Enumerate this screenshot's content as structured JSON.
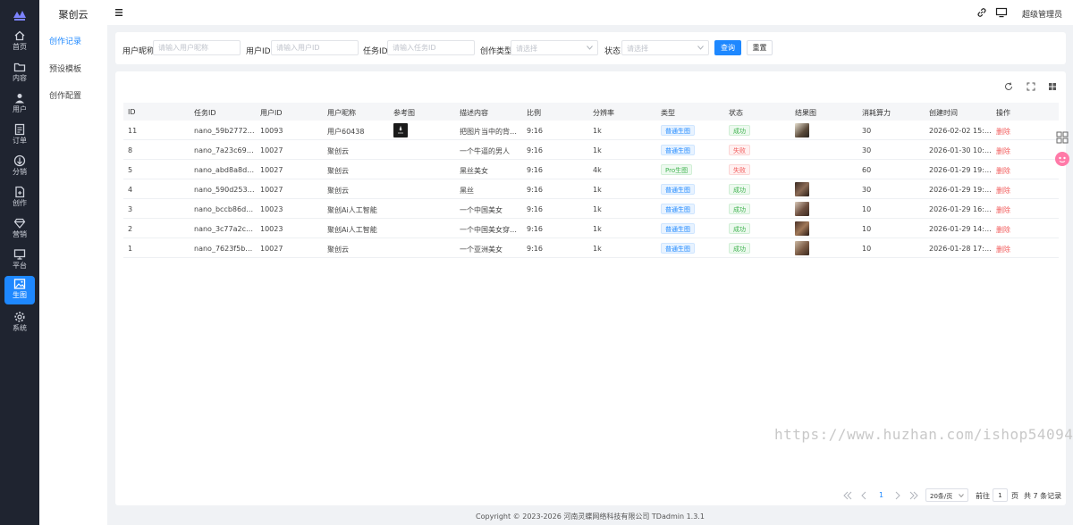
{
  "app": {
    "name": "聚创云"
  },
  "rail": [
    {
      "label": "首页",
      "icon": "home-icon"
    },
    {
      "label": "内容",
      "icon": "folder-icon"
    },
    {
      "label": "用户",
      "icon": "user-icon"
    },
    {
      "label": "订单",
      "icon": "order-icon"
    },
    {
      "label": "分销",
      "icon": "distribution-icon"
    },
    {
      "label": "创作",
      "icon": "create-icon"
    },
    {
      "label": "营销",
      "icon": "diamond-icon"
    },
    {
      "label": "平台",
      "icon": "monitor-icon"
    },
    {
      "label": "生图",
      "icon": "image-icon"
    },
    {
      "label": "系统",
      "icon": "gear-icon"
    }
  ],
  "subnav": {
    "title": "聚创云",
    "items": [
      "创作记录",
      "预设模板",
      "创作配置"
    ]
  },
  "header": {
    "user": "超级管理员"
  },
  "filters": {
    "user_name_label": "用户昵称",
    "user_name_placeholder": "请输入用户昵称",
    "user_id_label": "用户ID",
    "user_id_placeholder": "请输入用户ID",
    "task_id_label": "任务ID",
    "task_id_placeholder": "请输入任务ID",
    "type_label": "创作类型",
    "type_placeholder": "请选择",
    "status_label": "状态",
    "status_placeholder": "请选择",
    "search_btn": "查询",
    "reset_btn": "重置"
  },
  "table": {
    "columns": [
      "ID",
      "任务ID",
      "用户ID",
      "用户昵称",
      "参考图",
      "描述内容",
      "比例",
      "分辨率",
      "类型",
      "状态",
      "结果图",
      "消耗算力",
      "创建时间",
      "操作"
    ],
    "rows": [
      {
        "id": "11",
        "task": "nano_59b27724f4...",
        "uid": "10093",
        "nick": "用户60438",
        "ref": true,
        "desc": "把图片当中的背景...",
        "ratio": "9:16",
        "res": "1k",
        "type": "普通生图",
        "type_kind": "blue",
        "status": "成功",
        "status_kind": "green",
        "result": true,
        "cost": "30",
        "time": "2026-02-02 15:57:...",
        "op": "删除"
      },
      {
        "id": "8",
        "task": "nano_7a23c69780...",
        "uid": "10027",
        "nick": "聚创云",
        "ref": false,
        "desc": "一个牛逼的男人",
        "ratio": "9:16",
        "res": "1k",
        "type": "普通生图",
        "type_kind": "blue",
        "status": "失败",
        "status_kind": "red",
        "result": false,
        "cost": "30",
        "time": "2026-01-30 10:38:...",
        "op": "删除"
      },
      {
        "id": "5",
        "task": "nano_abd8a8d97...",
        "uid": "10027",
        "nick": "聚创云",
        "ref": false,
        "desc": "黑丝美女",
        "ratio": "9:16",
        "res": "4k",
        "type": "Pro生图",
        "type_kind": "green",
        "status": "失败",
        "status_kind": "red",
        "result": false,
        "cost": "60",
        "time": "2026-01-29 19:39:...",
        "op": "删除"
      },
      {
        "id": "4",
        "task": "nano_590d2533a...",
        "uid": "10027",
        "nick": "聚创云",
        "ref": false,
        "desc": "黑丝",
        "ratio": "9:16",
        "res": "1k",
        "type": "普通生图",
        "type_kind": "blue",
        "status": "成功",
        "status_kind": "green",
        "result": true,
        "cost": "30",
        "time": "2026-01-29 19:39:...",
        "op": "删除"
      },
      {
        "id": "3",
        "task": "nano_bccb86d358...",
        "uid": "10023",
        "nick": "聚创Ai人工智能",
        "ref": false,
        "desc": "一个中国美女",
        "ratio": "9:16",
        "res": "1k",
        "type": "普通生图",
        "type_kind": "blue",
        "status": "成功",
        "status_kind": "green",
        "result": true,
        "cost": "10",
        "time": "2026-01-29 16:51:...",
        "op": "删除"
      },
      {
        "id": "2",
        "task": "nano_3c77a2ce1e...",
        "uid": "10023",
        "nick": "聚创Ai人工智能",
        "ref": false,
        "desc": "一个中国美女穿着...",
        "ratio": "9:16",
        "res": "1k",
        "type": "普通生图",
        "type_kind": "blue",
        "status": "成功",
        "status_kind": "green",
        "result": true,
        "cost": "10",
        "time": "2026-01-29 14:48:...",
        "op": "删除"
      },
      {
        "id": "1",
        "task": "nano_7623f5b3df...",
        "uid": "10027",
        "nick": "聚创云",
        "ref": false,
        "desc": "一个亚洲美女",
        "ratio": "9:16",
        "res": "1k",
        "type": "普通生图",
        "type_kind": "blue",
        "status": "成功",
        "status_kind": "green",
        "result": true,
        "cost": "10",
        "time": "2026-01-28 17:57:...",
        "op": "删除"
      }
    ]
  },
  "pagination": {
    "current_page": "1",
    "page_size": "20条/页",
    "goto_label": "前往",
    "goto_value": "1",
    "page_unit": "页",
    "total": "共 7 条记录"
  },
  "footer": {
    "copyright": "Copyright © 2023-2026 河南灵蝶网络科技有限公司   TDadmin 1.3.1"
  },
  "watermark": "https://www.huzhan.com/ishop54094",
  "colors": {
    "accent": "#1e88ff",
    "rail_bg": "#1f2430",
    "danger": "#f25b5b",
    "success": "#3fb34f"
  }
}
